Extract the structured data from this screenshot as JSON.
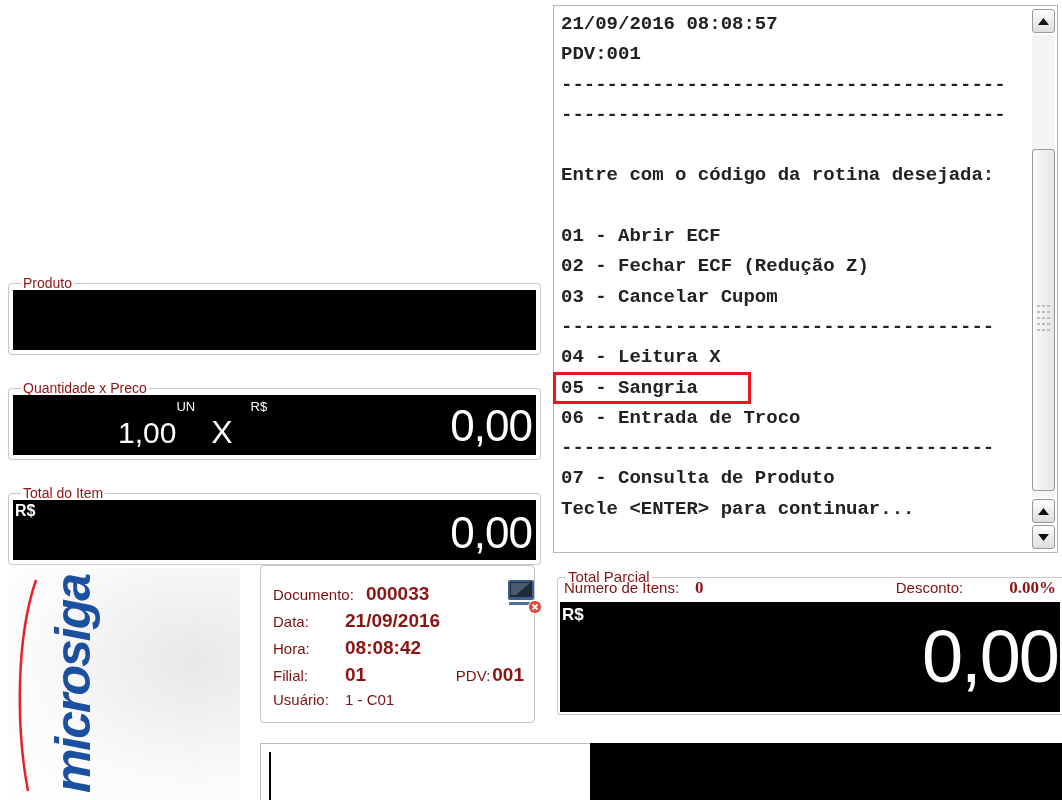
{
  "receipt": {
    "lines": [
      {
        "kind": "text",
        "text": "21/09/2016 08:08:57",
        "highlighted": false
      },
      {
        "kind": "text",
        "text": "PDV:001",
        "highlighted": false
      },
      {
        "kind": "text",
        "text": "---------------------------------------",
        "highlighted": false
      },
      {
        "kind": "text",
        "text": "---------------------------------------",
        "highlighted": false
      },
      {
        "kind": "blank",
        "highlighted": false
      },
      {
        "kind": "text",
        "text": "Entre com o código da rotina desejada:",
        "highlighted": false
      },
      {
        "kind": "blank",
        "highlighted": false
      },
      {
        "kind": "text",
        "text": "01 - Abrir ECF",
        "highlighted": false
      },
      {
        "kind": "text",
        "text": "02 - Fechar ECF (Redução Z)",
        "highlighted": false
      },
      {
        "kind": "text",
        "text": "03 - Cancelar Cupom",
        "highlighted": false
      },
      {
        "kind": "text",
        "text": "--------------------------------------",
        "highlighted": false
      },
      {
        "kind": "text",
        "text": "04 - Leitura X",
        "highlighted": false
      },
      {
        "kind": "text",
        "text": "05 - Sangria",
        "highlighted": true
      },
      {
        "kind": "text",
        "text": "06 - Entrada de Troco",
        "highlighted": false
      },
      {
        "kind": "text",
        "text": "--------------------------------------",
        "highlighted": false
      },
      {
        "kind": "text",
        "text": "07 - Consulta de Produto",
        "highlighted": false
      },
      {
        "kind": "text",
        "text": "Tecle <ENTER> para continuar...",
        "highlighted": false
      }
    ]
  },
  "product": {
    "legend": "Produto"
  },
  "quantity_price": {
    "legend": "Quantidade x Preco",
    "quantity": "1,00",
    "unit": "UN",
    "times": "X",
    "currency": "R$",
    "price": "0,00"
  },
  "item_total": {
    "legend": "Total do Item",
    "currency": "R$",
    "value": "0,00"
  },
  "logo": {
    "text": "microsiga"
  },
  "document_info": {
    "rows": [
      [
        {
          "label": "Documento:",
          "value": "000033",
          "kind": "bold"
        }
      ],
      [
        {
          "label": "Data:",
          "value": "21/09/2016",
          "kind": "bold"
        }
      ],
      [
        {
          "label": "Hora:",
          "value": "08:08:42",
          "kind": "bold"
        }
      ],
      [
        {
          "label": "Filial:",
          "value": "01",
          "kind": "bold"
        },
        {
          "label": "PDV:",
          "value": "001",
          "kind": "bold"
        }
      ],
      [
        {
          "label": "Usuário:",
          "value": "1 - C01",
          "kind": "plain"
        }
      ]
    ]
  },
  "partial_total": {
    "legend": "Total Parcial",
    "item_count_label": "Numero de Itens:",
    "item_count": "0",
    "discount_label": "Desconto:",
    "discount": "0.00%",
    "currency": "R$",
    "value": "0,00"
  }
}
